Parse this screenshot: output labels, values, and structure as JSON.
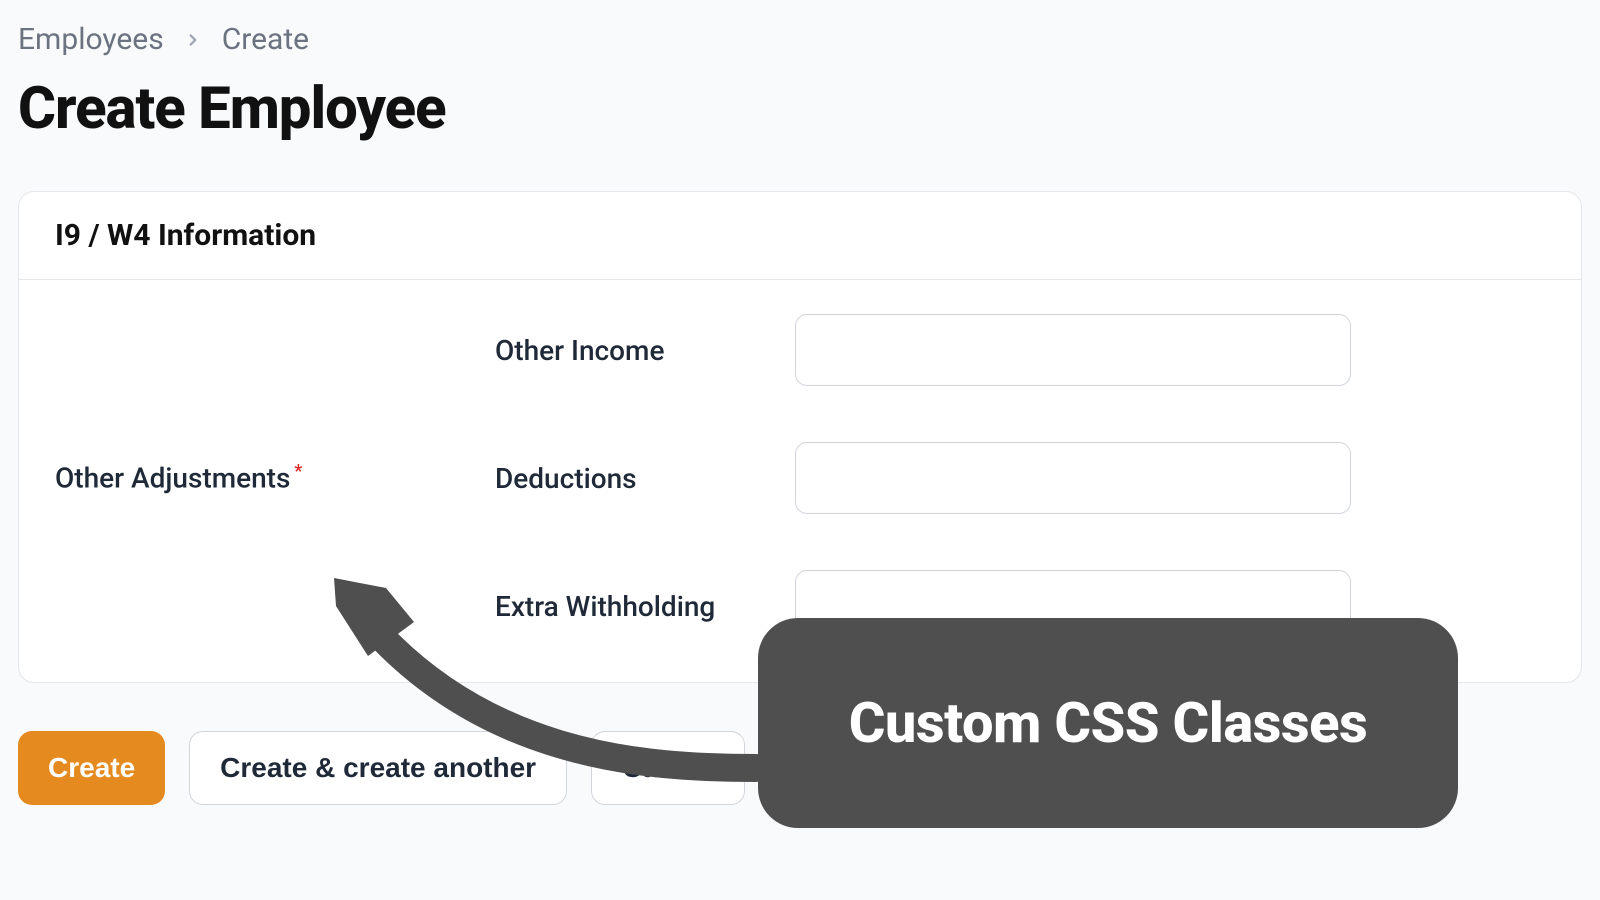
{
  "breadcrumb": {
    "parent": "Employees",
    "current": "Create"
  },
  "page": {
    "title": "Create Employee"
  },
  "card": {
    "title": "I9 / W4 Information",
    "section_label": "Other Adjustments",
    "fields": [
      {
        "label": "Other Income",
        "value": ""
      },
      {
        "label": "Deductions",
        "value": ""
      },
      {
        "label": "Extra Withholding",
        "value": ""
      }
    ]
  },
  "actions": {
    "create": "Create",
    "create_another": "Create & create another",
    "cancel": "Cancel"
  },
  "callout": {
    "text": "Custom CSS Classes"
  }
}
